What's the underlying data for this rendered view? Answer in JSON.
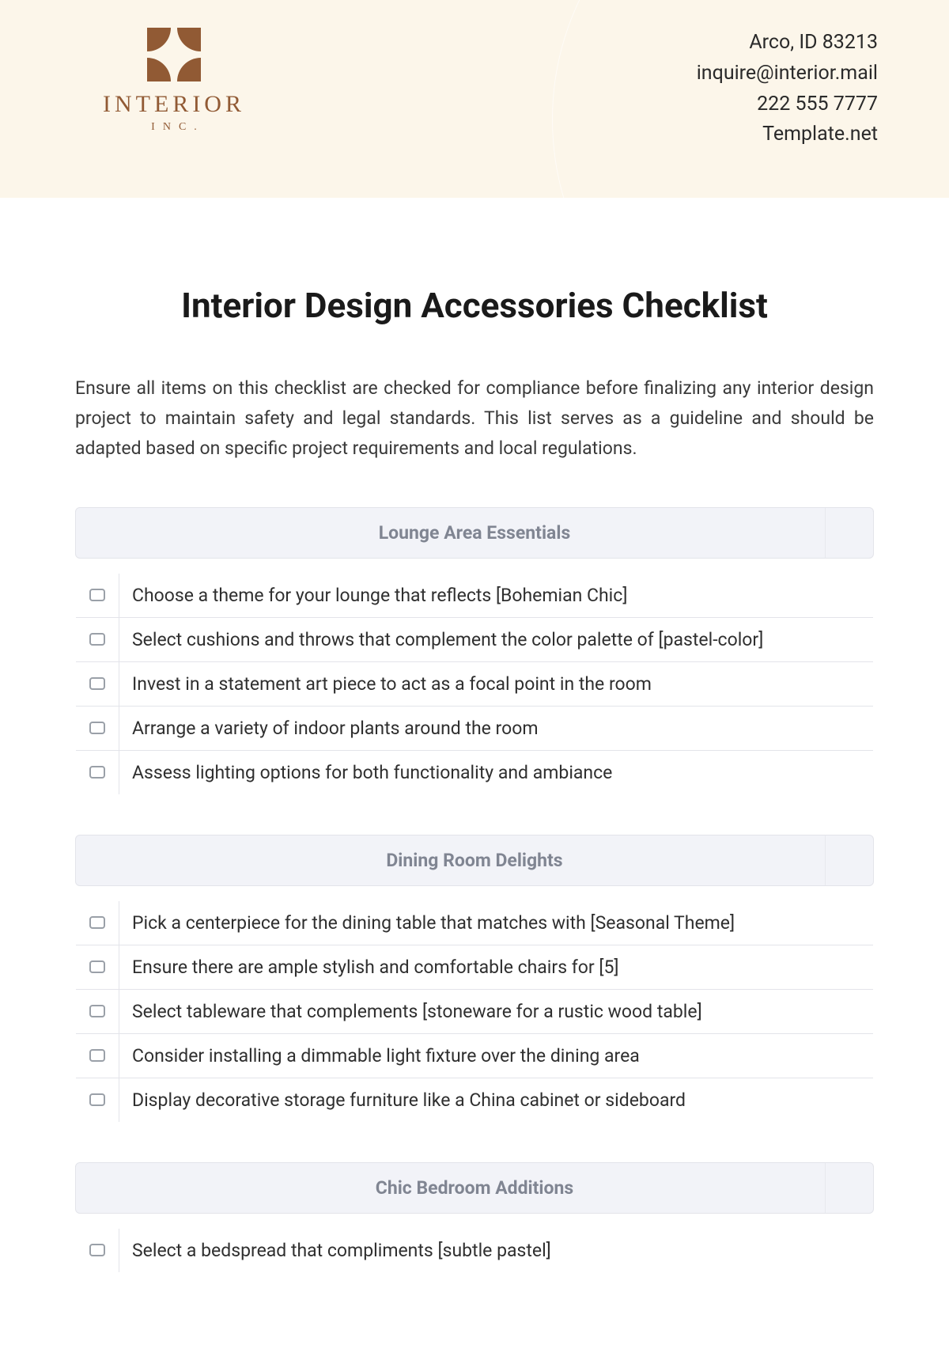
{
  "header": {
    "logo": {
      "name": "INTERIOR",
      "sub": "INC."
    },
    "contact": {
      "address": "Arco, ID 83213",
      "email": "inquire@interior.mail",
      "phone": "222 555 7777",
      "site": "Template.net"
    }
  },
  "document": {
    "title": "Interior Design Accessories Checklist",
    "intro": "Ensure all items on this checklist are checked for compliance before finalizing any interior design project to maintain safety and legal standards. This list serves as a guideline and should be adapted based on specific project requirements and local regulations."
  },
  "sections": [
    {
      "title": "Lounge Area Essentials",
      "items": [
        "Choose a theme for your lounge that reflects [Bohemian Chic]",
        "Select cushions and throws that complement the color palette of [pastel-color]",
        "Invest in a statement art piece to act as a focal point in the room",
        "Arrange a variety of indoor plants around the room",
        "Assess lighting options for both functionality and ambiance"
      ]
    },
    {
      "title": "Dining Room Delights",
      "items": [
        "Pick a centerpiece for the dining table that matches with [Seasonal Theme]",
        "Ensure there are ample stylish and comfortable chairs for [5]",
        "Select tableware that complements [stoneware for a rustic wood table]",
        "Consider installing a dimmable light fixture over the dining area",
        "Display decorative storage furniture like a China cabinet or sideboard"
      ]
    },
    {
      "title": "Chic Bedroom Additions",
      "items": [
        "Select a bedspread that compliments [subtle pastel]"
      ]
    }
  ]
}
